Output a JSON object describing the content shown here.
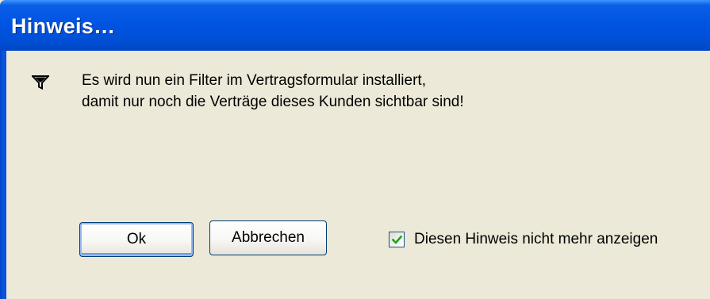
{
  "window": {
    "title": "Hinweis…"
  },
  "message": {
    "icon": "filter-icon",
    "line1": "Es wird nun ein Filter im Vertragsformular installiert,",
    "line2": "damit nur noch die Verträge dieses Kunden sichtbar sind!"
  },
  "buttons": {
    "ok_label": "Ok",
    "cancel_label": "Abbrechen"
  },
  "checkbox": {
    "label": "Diesen Hinweis nicht mehr anzeigen",
    "checked": true,
    "check_icon": "checkmark-icon"
  },
  "colors": {
    "titlebar": "#0054e3",
    "dialog_background": "#ece9d8",
    "checkmark": "#21a121"
  }
}
